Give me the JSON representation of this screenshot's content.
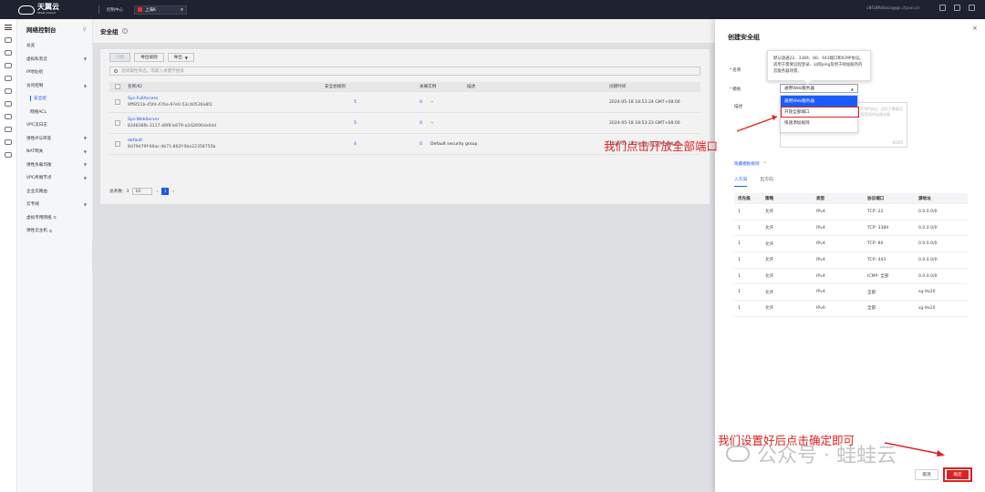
{
  "topbar": {
    "brand": "天翼云",
    "brand_sub": "State Cloud",
    "console": "控制中心",
    "region": "上海6",
    "account": "c8f18fb6aca@gs.ctyun.cn"
  },
  "sidebar": {
    "title": "网络控制台",
    "items": [
      {
        "label": "总览",
        "type": "plain"
      },
      {
        "label": "虚拟私有云",
        "type": "group"
      },
      {
        "label": "IP地址组",
        "type": "plain"
      },
      {
        "label": "访问控制",
        "type": "group-open"
      },
      {
        "label": "安全组",
        "type": "sub-active"
      },
      {
        "label": "网络ACL",
        "type": "sub"
      },
      {
        "label": "VPC流日志",
        "type": "plain"
      },
      {
        "label": "弹性IP与带宽",
        "type": "group"
      },
      {
        "label": "NAT网关",
        "type": "group"
      },
      {
        "label": "弹性负载均衡",
        "type": "group"
      },
      {
        "label": "VPC终端节点",
        "type": "group"
      },
      {
        "label": "企业云路由",
        "type": "plain"
      },
      {
        "label": "云专线",
        "type": "group"
      },
      {
        "label": "虚拟专用网络",
        "type": "ext"
      },
      {
        "label": "弹性云主机",
        "type": "ext"
      }
    ]
  },
  "main": {
    "title": "安全组",
    "buttons": {
      "create": "创建",
      "export_all": "导出规则",
      "export": "导出"
    },
    "filter_placeholder": "选择属性筛选，或输入关键字搜索",
    "columns": {
      "name": "名称/ID",
      "rules": "安全组规则",
      "assoc": "关联实例",
      "desc": "描述",
      "time": "创建时间"
    },
    "rows": [
      {
        "name": "Sys-FullAccess",
        "id": "9ff6f21b-45fd-476a-97e0-53c40536a8f2",
        "rules": "5",
        "assoc": "0",
        "desc": "--",
        "time": "2024-05-18 18:53:24 GMT+08:00"
      },
      {
        "name": "Sys-WebServer",
        "id": "834838fb-3117-48f8-b979-a2d2696de0dd",
        "rules": "5",
        "assoc": "0",
        "desc": "--",
        "time": "2024-05-18 18:53:23 GMT+08:00"
      },
      {
        "name": "default",
        "id": "8d79d79f-68ac-4b71-862f-0be22358755b",
        "rules": "4",
        "assoc": "0",
        "desc": "Default security group",
        "time": "2024-05-18 18:55:00 GMT+08:00"
      }
    ],
    "pager": {
      "total": "总条数：3",
      "size": "10",
      "page": "1"
    }
  },
  "drawer": {
    "title": "创建安全组",
    "name_label": "名称",
    "template_label": "模板",
    "desc_label": "描述",
    "template_value": "通用Web服务器",
    "desc_hint": "ICMP协议。适用于需要远程登录的云服务器",
    "desc_count": "0/255",
    "tooltip": "默认放通22、3389、80、443端口和ICMP协议。适用于需要远程登录、公网ping及用于网站服务的云服务器场景。",
    "dropdown": [
      "通用Web服务器",
      "开放全部端口",
      "快速添加规则"
    ],
    "rules_toggle": "隐藏模板规则",
    "tabs": {
      "inbound": "入方向",
      "outbound": "出方向"
    },
    "rule_columns": {
      "priority": "优先级",
      "policy": "策略",
      "type": "类型",
      "port": "协议端口",
      "source": "源地址"
    },
    "rules": [
      {
        "priority": "1",
        "policy": "允许",
        "type": "IPv4",
        "port": "TCP: 22",
        "source": "0.0.0.0/0"
      },
      {
        "priority": "1",
        "policy": "允许",
        "type": "IPv4",
        "port": "TCP: 3389",
        "source": "0.0.0.0/0"
      },
      {
        "priority": "1",
        "policy": "允许",
        "type": "IPv4",
        "port": "TCP: 80",
        "source": "0.0.0.0/0"
      },
      {
        "priority": "1",
        "policy": "允许",
        "type": "IPv4",
        "port": "TCP: 443",
        "source": "0.0.0.0/0"
      },
      {
        "priority": "1",
        "policy": "允许",
        "type": "IPv4",
        "port": "ICMP: 全部",
        "source": "0.0.0.0/0"
      },
      {
        "priority": "1",
        "policy": "允许",
        "type": "IPv4",
        "port": "全部",
        "source": "sg-9a20"
      },
      {
        "priority": "1",
        "policy": "允许",
        "type": "IPv6",
        "port": "全部",
        "source": "sg-9a20"
      }
    ],
    "cancel": "取消",
    "ok": "确定"
  },
  "annotations": {
    "open_ports": "我们点击开放全部端口",
    "confirm": "我们设置好后点击确定即可",
    "watermark": "公众号 · 蛙蛙云"
  },
  "colors": {
    "accent": "#1a5cff",
    "annotation": "#e02020",
    "topbar": "#1f2330"
  }
}
